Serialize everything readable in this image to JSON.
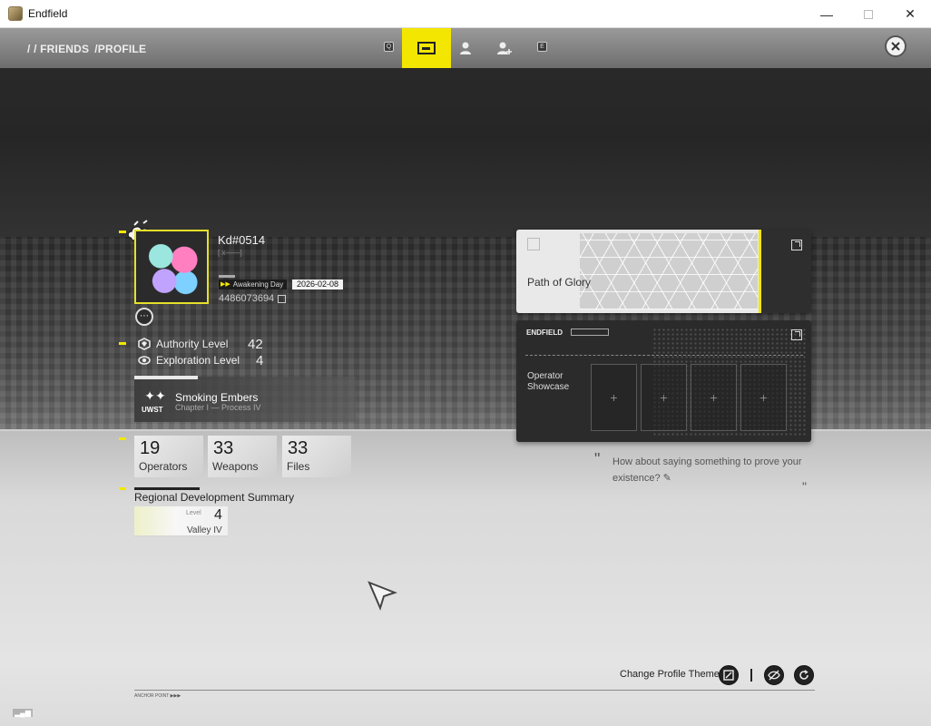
{
  "window": {
    "title": "Endfield",
    "minimize_glyph": "—",
    "close_glyph": "✕"
  },
  "nav": {
    "breadcrumb": [
      "/ / FRIENDS",
      "/PROFILE"
    ],
    "key_left": "Q",
    "key_right": "E",
    "tabs": [
      {
        "name": "profile-card-tab",
        "icon": "id-card-icon",
        "active": true
      },
      {
        "name": "friends-tab",
        "icon": "person-icon",
        "active": false
      },
      {
        "name": "add-friend-tab",
        "icon": "person-add-icon",
        "active": false
      }
    ],
    "accent_color": "#f3e600"
  },
  "profile": {
    "name": "Kd#0514",
    "name_sub": "[ x——]",
    "awakening_label": "Awakening Day",
    "awakening_arrows": "▶▶",
    "awakening_date": "2026-02-08",
    "uid": "4486073694",
    "more_glyph": "⋯",
    "authority_label": "Authority Level",
    "authority_value": "42",
    "exploration_label": "Exploration Level",
    "exploration_value": "4",
    "mission": {
      "logo": "UWST",
      "logo_glyph": "✦✦",
      "title": "Smoking Embers",
      "subtitle": "Chapter I — Process IV"
    },
    "stats": [
      {
        "value": "19",
        "label": "Operators"
      },
      {
        "value": "33",
        "label": "Weapons"
      },
      {
        "value": "33",
        "label": "Files"
      }
    ],
    "region": {
      "title": "Regional Development Summary",
      "level_label": "Level",
      "level_value": "4",
      "name": "Valley IV"
    }
  },
  "cards": {
    "glory_title": "Path of Glory",
    "showcase_brand": "ENDFIELD",
    "showcase_label": "Operator Showcase",
    "slot_glyph": "+"
  },
  "signature": {
    "quote_open": "\"",
    "text": "How about saying something to prove your existence?",
    "quote_close": "\"",
    "edit_glyph": "✎"
  },
  "footer": {
    "anchor": "ANCHOR POINT",
    "anchor_arrows": "▶▶▶",
    "change_theme": "Change Profile Theme"
  }
}
